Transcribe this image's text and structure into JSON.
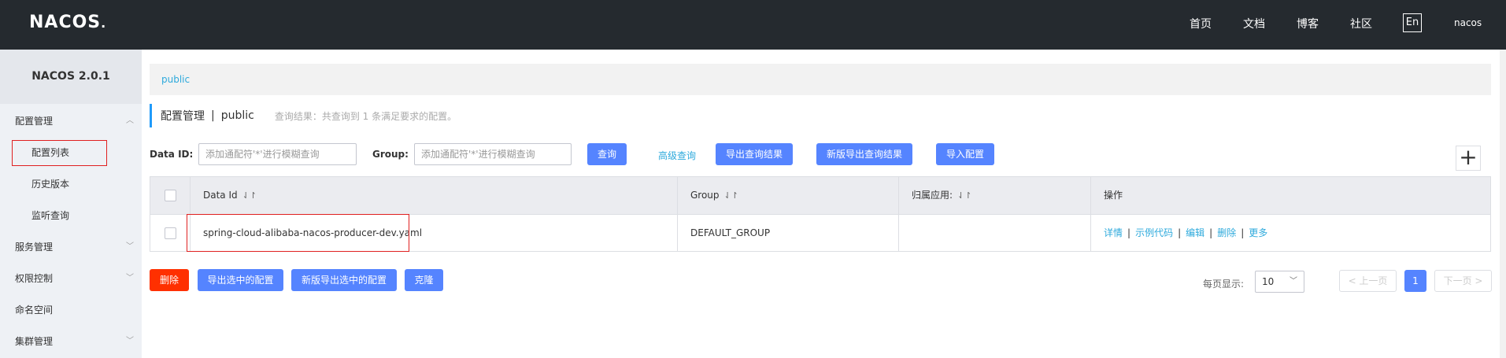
{
  "app": {
    "logo": "NACOS",
    "logo_suffix": "."
  },
  "topnav": {
    "items": [
      "首页",
      "文档",
      "博客",
      "社区"
    ],
    "lang": "En",
    "user": "nacos"
  },
  "sidebar": {
    "version": "NACOS 2.0.1",
    "items": [
      {
        "label": "配置管理",
        "arrow": "︿"
      },
      {
        "label": "配置列表"
      },
      {
        "label": "历史版本"
      },
      {
        "label": "监听查询"
      },
      {
        "label": "服务管理",
        "arrow": "﹀"
      },
      {
        "label": "权限控制",
        "arrow": "﹀"
      },
      {
        "label": "命名空间"
      },
      {
        "label": "集群管理",
        "arrow": "﹀"
      }
    ]
  },
  "breadcrumb": {
    "namespace": "public"
  },
  "page": {
    "title": "配置管理",
    "separator": "|",
    "namespace": "public",
    "result_text": "查询结果：共查询到 1 条满足要求的配置。"
  },
  "filters": {
    "data_id_label": "Data ID:",
    "data_id_placeholder": "添加通配符'*'进行模糊查询",
    "group_label": "Group:",
    "group_placeholder": "添加通配符'*'进行模糊查询",
    "query_button": "查询",
    "advanced_query": "高级查询",
    "export_results": "导出查询结果",
    "new_export_results": "新版导出查询结果",
    "import_config": "导入配置",
    "add_icon": "plus-icon"
  },
  "table": {
    "columns": [
      "Data Id",
      "Group",
      "归属应用:",
      "操作"
    ],
    "sort_icon": "sort-icon",
    "rows": [
      {
        "data_id": "spring-cloud-alibaba-nacos-producer-dev.yaml",
        "group": "DEFAULT_GROUP",
        "app": "",
        "ops": [
          "详情",
          "示例代码",
          "编辑",
          "删除",
          "更多"
        ]
      }
    ]
  },
  "actions": {
    "delete": "删除",
    "export_selected": "导出选中的配置",
    "new_export_selected": "新版导出选中的配置",
    "clone": "克隆"
  },
  "pagination": {
    "page_size_label": "每页显示:",
    "page_size": "10",
    "prev": "< 上一页",
    "current": "1",
    "next": "下一页 >"
  },
  "colors": {
    "header_bg": "#252a2f",
    "primary": "#5584ff",
    "danger": "#ff3000",
    "link": "#2eaadc",
    "highlight_border": "#e02020"
  }
}
